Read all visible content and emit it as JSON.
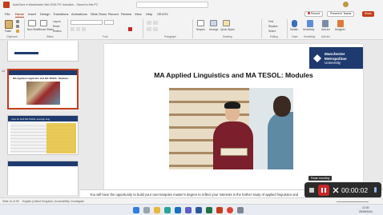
{
  "window": {
    "title": "AutoSave  ●  Manchester Met 2024 PG Induction - Saved to this PC",
    "record_label": "Record",
    "present_teams_label": "Present in Teams",
    "share_label": "Share"
  },
  "menu": {
    "tabs": [
      "File",
      "Home",
      "Insert",
      "Design",
      "Transitions",
      "Animations",
      "Slide Show",
      "Record",
      "Review",
      "View",
      "Help",
      "VEVOX"
    ],
    "active_index": 1
  },
  "ribbon": {
    "paste_label": "Paste",
    "new_slide_label": "New Slide",
    "reuse_label": "Reuse Slides",
    "layout_label": "Layout",
    "reset_label": "Reset",
    "section_label": "Section",
    "find_label": "Find",
    "replace_label": "Replace",
    "select_label": "Select",
    "shapes_label": "Shapes",
    "arrange_label": "Arrange",
    "quick_styles_label": "Quick Styles",
    "dictate_label": "Dictate",
    "sensitivity_label": "Sensitivity",
    "addins_label": "Add-ins",
    "designer_label": "Designer",
    "groups": [
      "Clipboard",
      "Slides",
      "Font",
      "Paragraph",
      "Drawing",
      "Editing",
      "Voice",
      "Sensitivity",
      "Add-ins"
    ]
  },
  "thumbnails": {
    "current_number": "14",
    "current_title": "MA Applied Linguistics and MA TESOL: Modules",
    "next_title": "Core for both MA TESOL and App Ling"
  },
  "slide": {
    "title": "MA Applied Linguistics and MA TESOL: Modules",
    "logo_line1": "Manchester",
    "logo_line2": "Metropolitan",
    "logo_line3": "University"
  },
  "notes": {
    "text": "You will have the opportunity to build your own bespoke master's degree to reflect your interests in the further study of applied linguistics and"
  },
  "statusbar": {
    "slide_count": "Slide 14 of 59",
    "language": "English (United Kingdom)",
    "accessibility": "Accessibility: Investigate"
  },
  "recorder": {
    "tooltip": "Pause recording",
    "time": "00:00:02"
  },
  "taskbar": {
    "time": "12:00",
    "date": "25/09/2024"
  },
  "colors": {
    "brand_navy": "#1f3a6e",
    "accent_red": "#b7472a",
    "record_red": "#c62828"
  }
}
